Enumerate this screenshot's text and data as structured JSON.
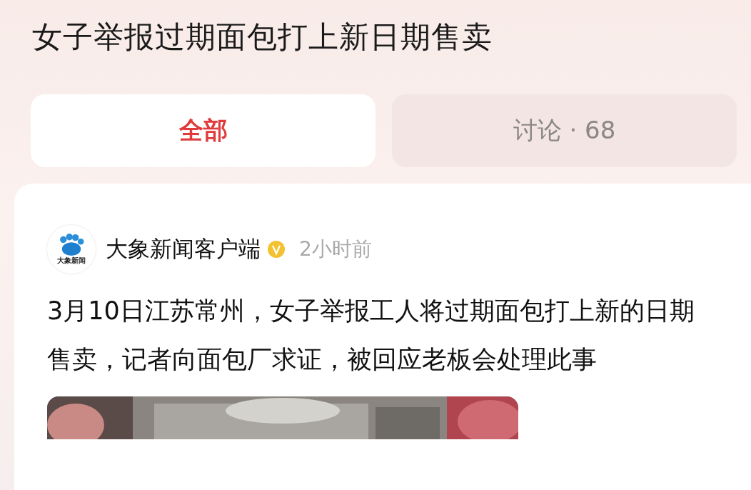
{
  "title": "女子举报过期面包打上新日期售卖",
  "tabs": [
    {
      "label": "全部",
      "selected": true
    },
    {
      "label": "讨论 · 68",
      "selected": false
    }
  ],
  "post": {
    "avatar_text": "大象新闻",
    "author": "大象新闻客户端",
    "verified": true,
    "time": "2小时前",
    "text": "3月10日江苏常州，女子举报工人将过期面包打上新的日期售卖，记者向面包厂求证，被回应老板会处理此事"
  }
}
